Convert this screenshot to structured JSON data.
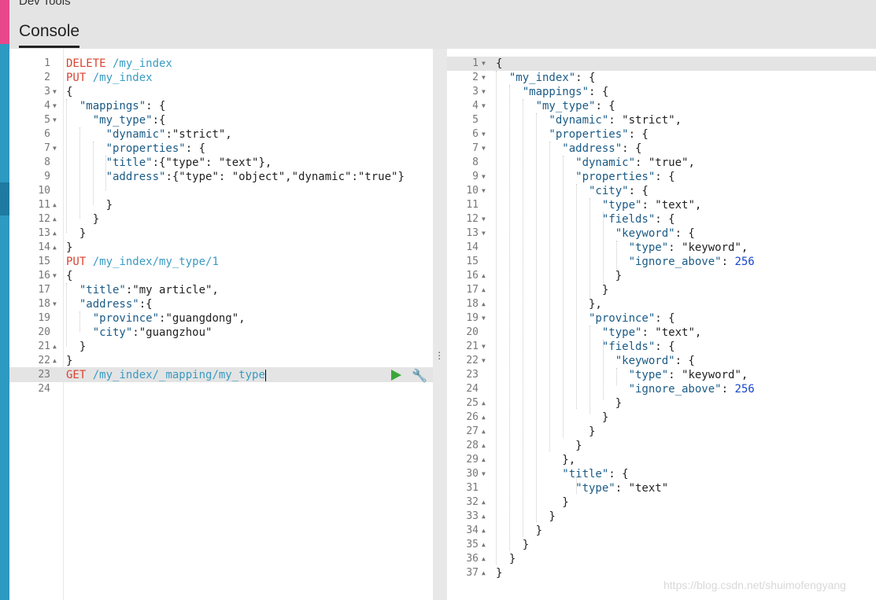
{
  "app": {
    "title": "Dev Tools",
    "tab": "Console"
  },
  "request_lines": [
    [
      {
        "t": "DELETE",
        "c": "c-method"
      },
      {
        "t": " /my_index",
        "c": "c-path"
      }
    ],
    [
      {
        "t": "PUT",
        "c": "c-method"
      },
      {
        "t": " /my_index",
        "c": "c-path"
      }
    ],
    [
      {
        "t": "{",
        "c": "c-punc"
      }
    ],
    [
      {
        "t": "  \"mappings\"",
        "c": "c-key"
      },
      {
        "t": ": {",
        "c": "c-punc"
      }
    ],
    [
      {
        "t": "    \"my_type\"",
        "c": "c-key"
      },
      {
        "t": ":{",
        "c": "c-punc"
      }
    ],
    [
      {
        "t": "      \"dynamic\"",
        "c": "c-key"
      },
      {
        "t": ":\"strict\",",
        "c": "c-str"
      }
    ],
    [
      {
        "t": "      \"properties\"",
        "c": "c-key"
      },
      {
        "t": ": {",
        "c": "c-punc"
      }
    ],
    [
      {
        "t": "      \"title\"",
        "c": "c-key"
      },
      {
        "t": ":{\"type\": \"text\"},",
        "c": "c-str"
      }
    ],
    [
      {
        "t": "      \"address\"",
        "c": "c-key"
      },
      {
        "t": ":{\"type\": \"object\",\"dynamic\":\"true\"}",
        "c": "c-str"
      }
    ],
    [
      {
        "t": "",
        "c": "c-punc"
      }
    ],
    [
      {
        "t": "      }",
        "c": "c-punc"
      }
    ],
    [
      {
        "t": "    }",
        "c": "c-punc"
      }
    ],
    [
      {
        "t": "  }",
        "c": "c-punc"
      }
    ],
    [
      {
        "t": "}",
        "c": "c-punc"
      }
    ],
    [
      {
        "t": "PUT",
        "c": "c-method"
      },
      {
        "t": " /my_index/my_type/1",
        "c": "c-path"
      }
    ],
    [
      {
        "t": "{",
        "c": "c-punc"
      }
    ],
    [
      {
        "t": "  \"title\"",
        "c": "c-key"
      },
      {
        "t": ":\"my article\",",
        "c": "c-str"
      }
    ],
    [
      {
        "t": "  \"address\"",
        "c": "c-key"
      },
      {
        "t": ":{",
        "c": "c-punc"
      }
    ],
    [
      {
        "t": "    \"province\"",
        "c": "c-key"
      },
      {
        "t": ":\"guangdong\",",
        "c": "c-str"
      }
    ],
    [
      {
        "t": "    \"city\"",
        "c": "c-key"
      },
      {
        "t": ":\"guangzhou\"",
        "c": "c-str"
      }
    ],
    [
      {
        "t": "  }",
        "c": "c-punc"
      }
    ],
    [
      {
        "t": "}",
        "c": "c-punc"
      }
    ],
    [
      {
        "t": "GET",
        "c": "c-method"
      },
      {
        "t": " /my_index/_mapping/my_type",
        "c": "c-path"
      }
    ],
    []
  ],
  "request_folds": {
    "3": "down",
    "4": "down",
    "5": "down",
    "7": "down",
    "11": "up",
    "12": "up",
    "13": "up",
    "14": "up",
    "16": "down",
    "18": "down",
    "21": "up",
    "22": "up"
  },
  "response_lines": [
    [
      {
        "t": "{",
        "c": "c-punc"
      }
    ],
    [
      {
        "t": "  \"my_index\"",
        "c": "c-key"
      },
      {
        "t": ": {",
        "c": "c-punc"
      }
    ],
    [
      {
        "t": "    \"mappings\"",
        "c": "c-key"
      },
      {
        "t": ": {",
        "c": "c-punc"
      }
    ],
    [
      {
        "t": "      \"my_type\"",
        "c": "c-key"
      },
      {
        "t": ": {",
        "c": "c-punc"
      }
    ],
    [
      {
        "t": "        \"dynamic\"",
        "c": "c-key"
      },
      {
        "t": ": \"strict\",",
        "c": "c-str"
      }
    ],
    [
      {
        "t": "        \"properties\"",
        "c": "c-key"
      },
      {
        "t": ": {",
        "c": "c-punc"
      }
    ],
    [
      {
        "t": "          \"address\"",
        "c": "c-key"
      },
      {
        "t": ": {",
        "c": "c-punc"
      }
    ],
    [
      {
        "t": "            \"dynamic\"",
        "c": "c-key"
      },
      {
        "t": ": \"true\",",
        "c": "c-str"
      }
    ],
    [
      {
        "t": "            \"properties\"",
        "c": "c-key"
      },
      {
        "t": ": {",
        "c": "c-punc"
      }
    ],
    [
      {
        "t": "              \"city\"",
        "c": "c-key"
      },
      {
        "t": ": {",
        "c": "c-punc"
      }
    ],
    [
      {
        "t": "                \"type\"",
        "c": "c-key"
      },
      {
        "t": ": \"text\",",
        "c": "c-str"
      }
    ],
    [
      {
        "t": "                \"fields\"",
        "c": "c-key"
      },
      {
        "t": ": {",
        "c": "c-punc"
      }
    ],
    [
      {
        "t": "                  \"keyword\"",
        "c": "c-key"
      },
      {
        "t": ": {",
        "c": "c-punc"
      }
    ],
    [
      {
        "t": "                    \"type\"",
        "c": "c-key"
      },
      {
        "t": ": \"keyword\",",
        "c": "c-str"
      }
    ],
    [
      {
        "t": "                    \"ignore_above\"",
        "c": "c-key"
      },
      {
        "t": ": ",
        "c": "c-punc"
      },
      {
        "t": "256",
        "c": "c-num"
      }
    ],
    [
      {
        "t": "                  }",
        "c": "c-punc"
      }
    ],
    [
      {
        "t": "                }",
        "c": "c-punc"
      }
    ],
    [
      {
        "t": "              },",
        "c": "c-punc"
      }
    ],
    [
      {
        "t": "              \"province\"",
        "c": "c-key"
      },
      {
        "t": ": {",
        "c": "c-punc"
      }
    ],
    [
      {
        "t": "                \"type\"",
        "c": "c-key"
      },
      {
        "t": ": \"text\",",
        "c": "c-str"
      }
    ],
    [
      {
        "t": "                \"fields\"",
        "c": "c-key"
      },
      {
        "t": ": {",
        "c": "c-punc"
      }
    ],
    [
      {
        "t": "                  \"keyword\"",
        "c": "c-key"
      },
      {
        "t": ": {",
        "c": "c-punc"
      }
    ],
    [
      {
        "t": "                    \"type\"",
        "c": "c-key"
      },
      {
        "t": ": \"keyword\",",
        "c": "c-str"
      }
    ],
    [
      {
        "t": "                    \"ignore_above\"",
        "c": "c-key"
      },
      {
        "t": ": ",
        "c": "c-punc"
      },
      {
        "t": "256",
        "c": "c-num"
      }
    ],
    [
      {
        "t": "                  }",
        "c": "c-punc"
      }
    ],
    [
      {
        "t": "                }",
        "c": "c-punc"
      }
    ],
    [
      {
        "t": "              }",
        "c": "c-punc"
      }
    ],
    [
      {
        "t": "            }",
        "c": "c-punc"
      }
    ],
    [
      {
        "t": "          },",
        "c": "c-punc"
      }
    ],
    [
      {
        "t": "          \"title\"",
        "c": "c-key"
      },
      {
        "t": ": {",
        "c": "c-punc"
      }
    ],
    [
      {
        "t": "            \"type\"",
        "c": "c-key"
      },
      {
        "t": ": \"text\"",
        "c": "c-str"
      }
    ],
    [
      {
        "t": "          }",
        "c": "c-punc"
      }
    ],
    [
      {
        "t": "        }",
        "c": "c-punc"
      }
    ],
    [
      {
        "t": "      }",
        "c": "c-punc"
      }
    ],
    [
      {
        "t": "    }",
        "c": "c-punc"
      }
    ],
    [
      {
        "t": "  }",
        "c": "c-punc"
      }
    ],
    [
      {
        "t": "}",
        "c": "c-punc"
      }
    ]
  ],
  "response_folds": {
    "1": "down",
    "2": "down",
    "3": "down",
    "4": "down",
    "6": "down",
    "7": "down",
    "9": "down",
    "10": "down",
    "12": "down",
    "13": "down",
    "16": "up",
    "17": "up",
    "18": "up",
    "19": "down",
    "21": "down",
    "22": "down",
    "25": "up",
    "26": "up",
    "27": "up",
    "28": "up",
    "29": "up",
    "30": "down",
    "32": "up",
    "33": "up",
    "34": "up",
    "35": "up",
    "36": "up",
    "37": "up"
  },
  "icons": {
    "run": "play-icon",
    "settings": "wrench-icon"
  },
  "watermark": "https://blog.csdn.net/shuimofengyang",
  "colors": {
    "method": "#d9432f",
    "path": "#3a9bc2",
    "key": "#1a5b86",
    "number": "#1846c9",
    "nav": "#2d9ac1",
    "nav_accent": "#e8488b"
  }
}
